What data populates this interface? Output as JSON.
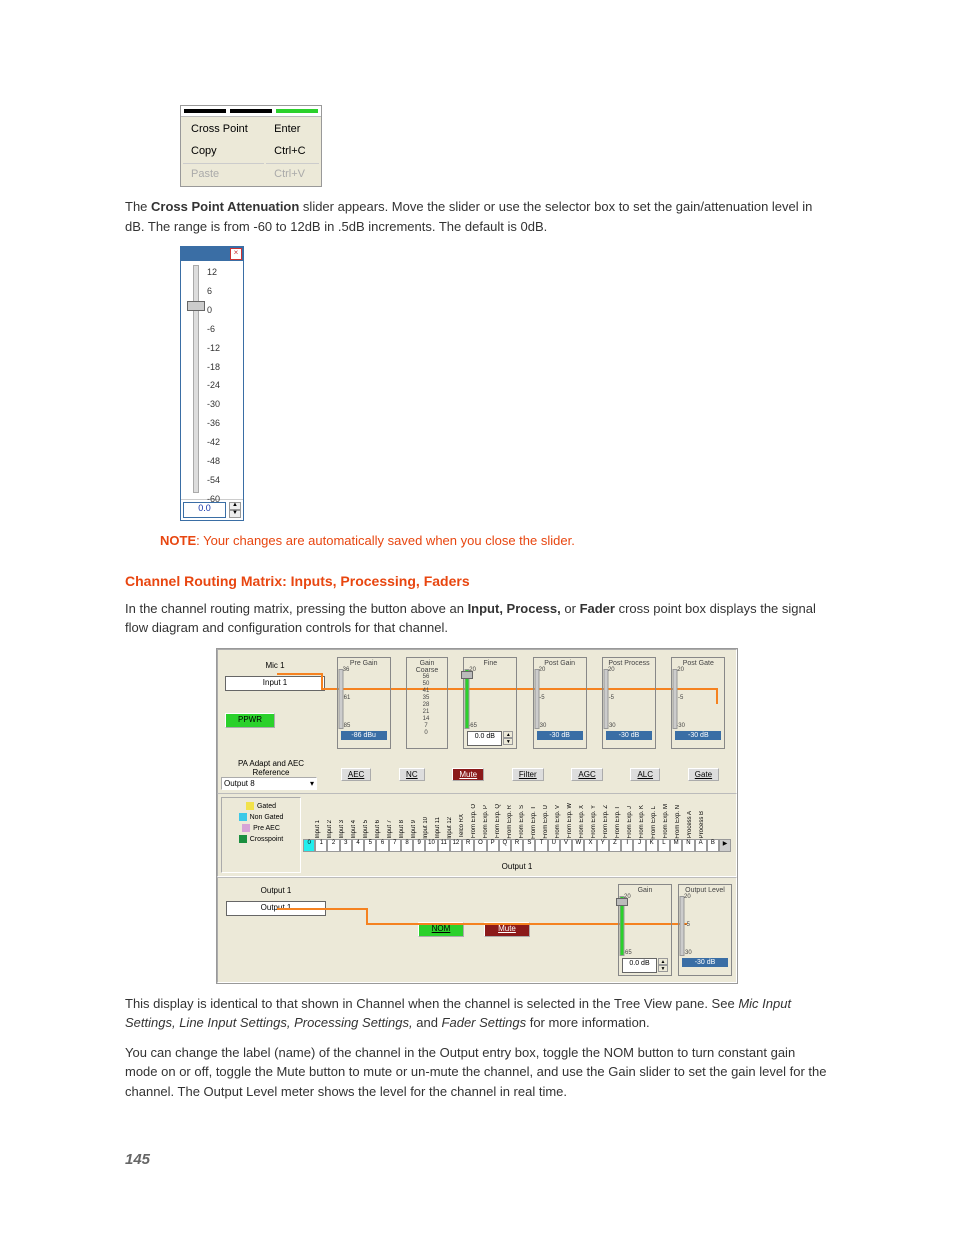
{
  "context_menu": {
    "items": [
      {
        "label": "Cross Point",
        "shortcut": "Enter",
        "enabled": true
      },
      {
        "label": "Copy",
        "shortcut": "Ctrl+C",
        "enabled": true
      },
      {
        "label": "Paste",
        "shortcut": "Ctrl+V",
        "enabled": false
      }
    ]
  },
  "para1a": "The ",
  "para1b": "Cross Point Attenuation",
  "para1c": " slider appears. Move the slider or use the selector box to set the gain/attenuation level in dB. The range is from -60 to 12dB in .5dB increments. The default is 0dB.",
  "slider_popup": {
    "ticks": [
      "12",
      "6",
      "0",
      "-6",
      "-12",
      "-18",
      "-24",
      "-30",
      "-36",
      "-42",
      "-48",
      "-54",
      "-60"
    ],
    "value": "0.0"
  },
  "note_label": "NOTE",
  "note_body": ": Your changes are automatically saved when you close the slider.",
  "section2": "Channel Routing Matrix: Inputs, Processing, Faders",
  "para2a": "In the channel routing matrix, pressing the button above an ",
  "para2b": "Input, Process,",
  "para2c": " or ",
  "para2d": "Fader",
  "para2e": " cross point box displays the signal flow diagram and configuration controls for that channel.",
  "flow": {
    "mic_label": "Mic 1",
    "input_box": "Input 1",
    "ppwr": "PPWR",
    "stages": {
      "pre_gain": {
        "title": "Pre Gain",
        "top": "36",
        "mid": "-61",
        "bot": "-85",
        "val": "-86 dBu"
      },
      "gain_coarse": {
        "title": "Gain\nCoarse",
        "ticks": [
          "56",
          "50",
          "41",
          "35",
          "28",
          "21",
          "14",
          "7",
          "0"
        ]
      },
      "fine": {
        "title": "Fine",
        "top": "20",
        "bot": "-65",
        "val": "0.0 dB"
      },
      "post_gain": {
        "title": "Post Gain",
        "top": "20",
        "mid": "-5",
        "bot": "-30",
        "val": "-30 dB"
      },
      "post_process": {
        "title": "Post Process",
        "top": "20",
        "mid": "-5",
        "bot": "-30",
        "val": "-30 dB"
      },
      "post_gate": {
        "title": "Post Gate",
        "top": "20",
        "mid": "-5",
        "bot": "-30",
        "val": "-30 dB"
      }
    },
    "aec_row": {
      "label": "PA Adapt and AEC Reference",
      "dropdown": "Output 8",
      "buttons": [
        "AEC",
        "NC",
        "Mute",
        "Filter",
        "AGC",
        "ALC",
        "Gate"
      ]
    },
    "legend": [
      {
        "name": "Gated",
        "color": "#f2e24b"
      },
      {
        "name": "Non Gated",
        "color": "#3cc9e8"
      },
      {
        "name": "Pre AEC",
        "color": "#d7a3d7"
      },
      {
        "name": "Crosspoint",
        "color": "#1a8f3f"
      }
    ],
    "matrix": {
      "headers": [
        "Input 1",
        "Input 2",
        "Input 3",
        "Input 4",
        "Input 5",
        "Input 6",
        "Input 7",
        "Input 8",
        "Input 9",
        "Input 10",
        "Input 11",
        "Input 12",
        "Telco RX",
        "From Exp. O",
        "From Exp. P",
        "From Exp. Q",
        "From Exp. R",
        "From Exp. S",
        "From Exp. T",
        "From Exp. U",
        "From Exp. V",
        "From Exp. W",
        "From Exp. X",
        "From Exp. Y",
        "From Exp. Z",
        "From Exp. I",
        "From Exp. J",
        "From Exp. K",
        "From Exp. L",
        "From Exp. M",
        "From Exp. N",
        "Process A",
        "Process B"
      ],
      "cells": [
        "1",
        "2",
        "3",
        "4",
        "5",
        "6",
        "7",
        "8",
        "9",
        "10",
        "11",
        "12",
        "R",
        "O",
        "P",
        "Q",
        "R",
        "S",
        "T",
        "U",
        "V",
        "W",
        "X",
        "Y",
        "Z",
        "I",
        "J",
        "K",
        "L",
        "M",
        "N",
        "A",
        "B"
      ],
      "row_label": "Output 1",
      "first_cyan": "0"
    },
    "output": {
      "label": "Output 1",
      "box": "Output 1",
      "nom": "NOM",
      "mute": "Mute",
      "gain": {
        "title": "Gain",
        "top": "20",
        "bot": "-65",
        "val": "0.0 dB"
      },
      "outlevel": {
        "title": "Output Level",
        "top": "20",
        "mid": "-5",
        "bot": "-30",
        "val": "-30 dB"
      }
    }
  },
  "para3a": "This display is identical to that shown in Channel when the channel is selected in the Tree View pane. See ",
  "para3b": "Mic Input Settings, Line Input Settings, Processing Settings,",
  "para3c": " and ",
  "para3d": "Fader Settings",
  "para3e": " for more information.",
  "para4": "You can change the label (name) of the channel in the Output entry box, toggle the NOM button to turn constant gain mode on or off, toggle the Mute button to mute or un-mute the channel, and use the Gain slider to set the gain level for the channel. The Output Level meter shows the level for the channel in real time.",
  "pagenum": "145"
}
